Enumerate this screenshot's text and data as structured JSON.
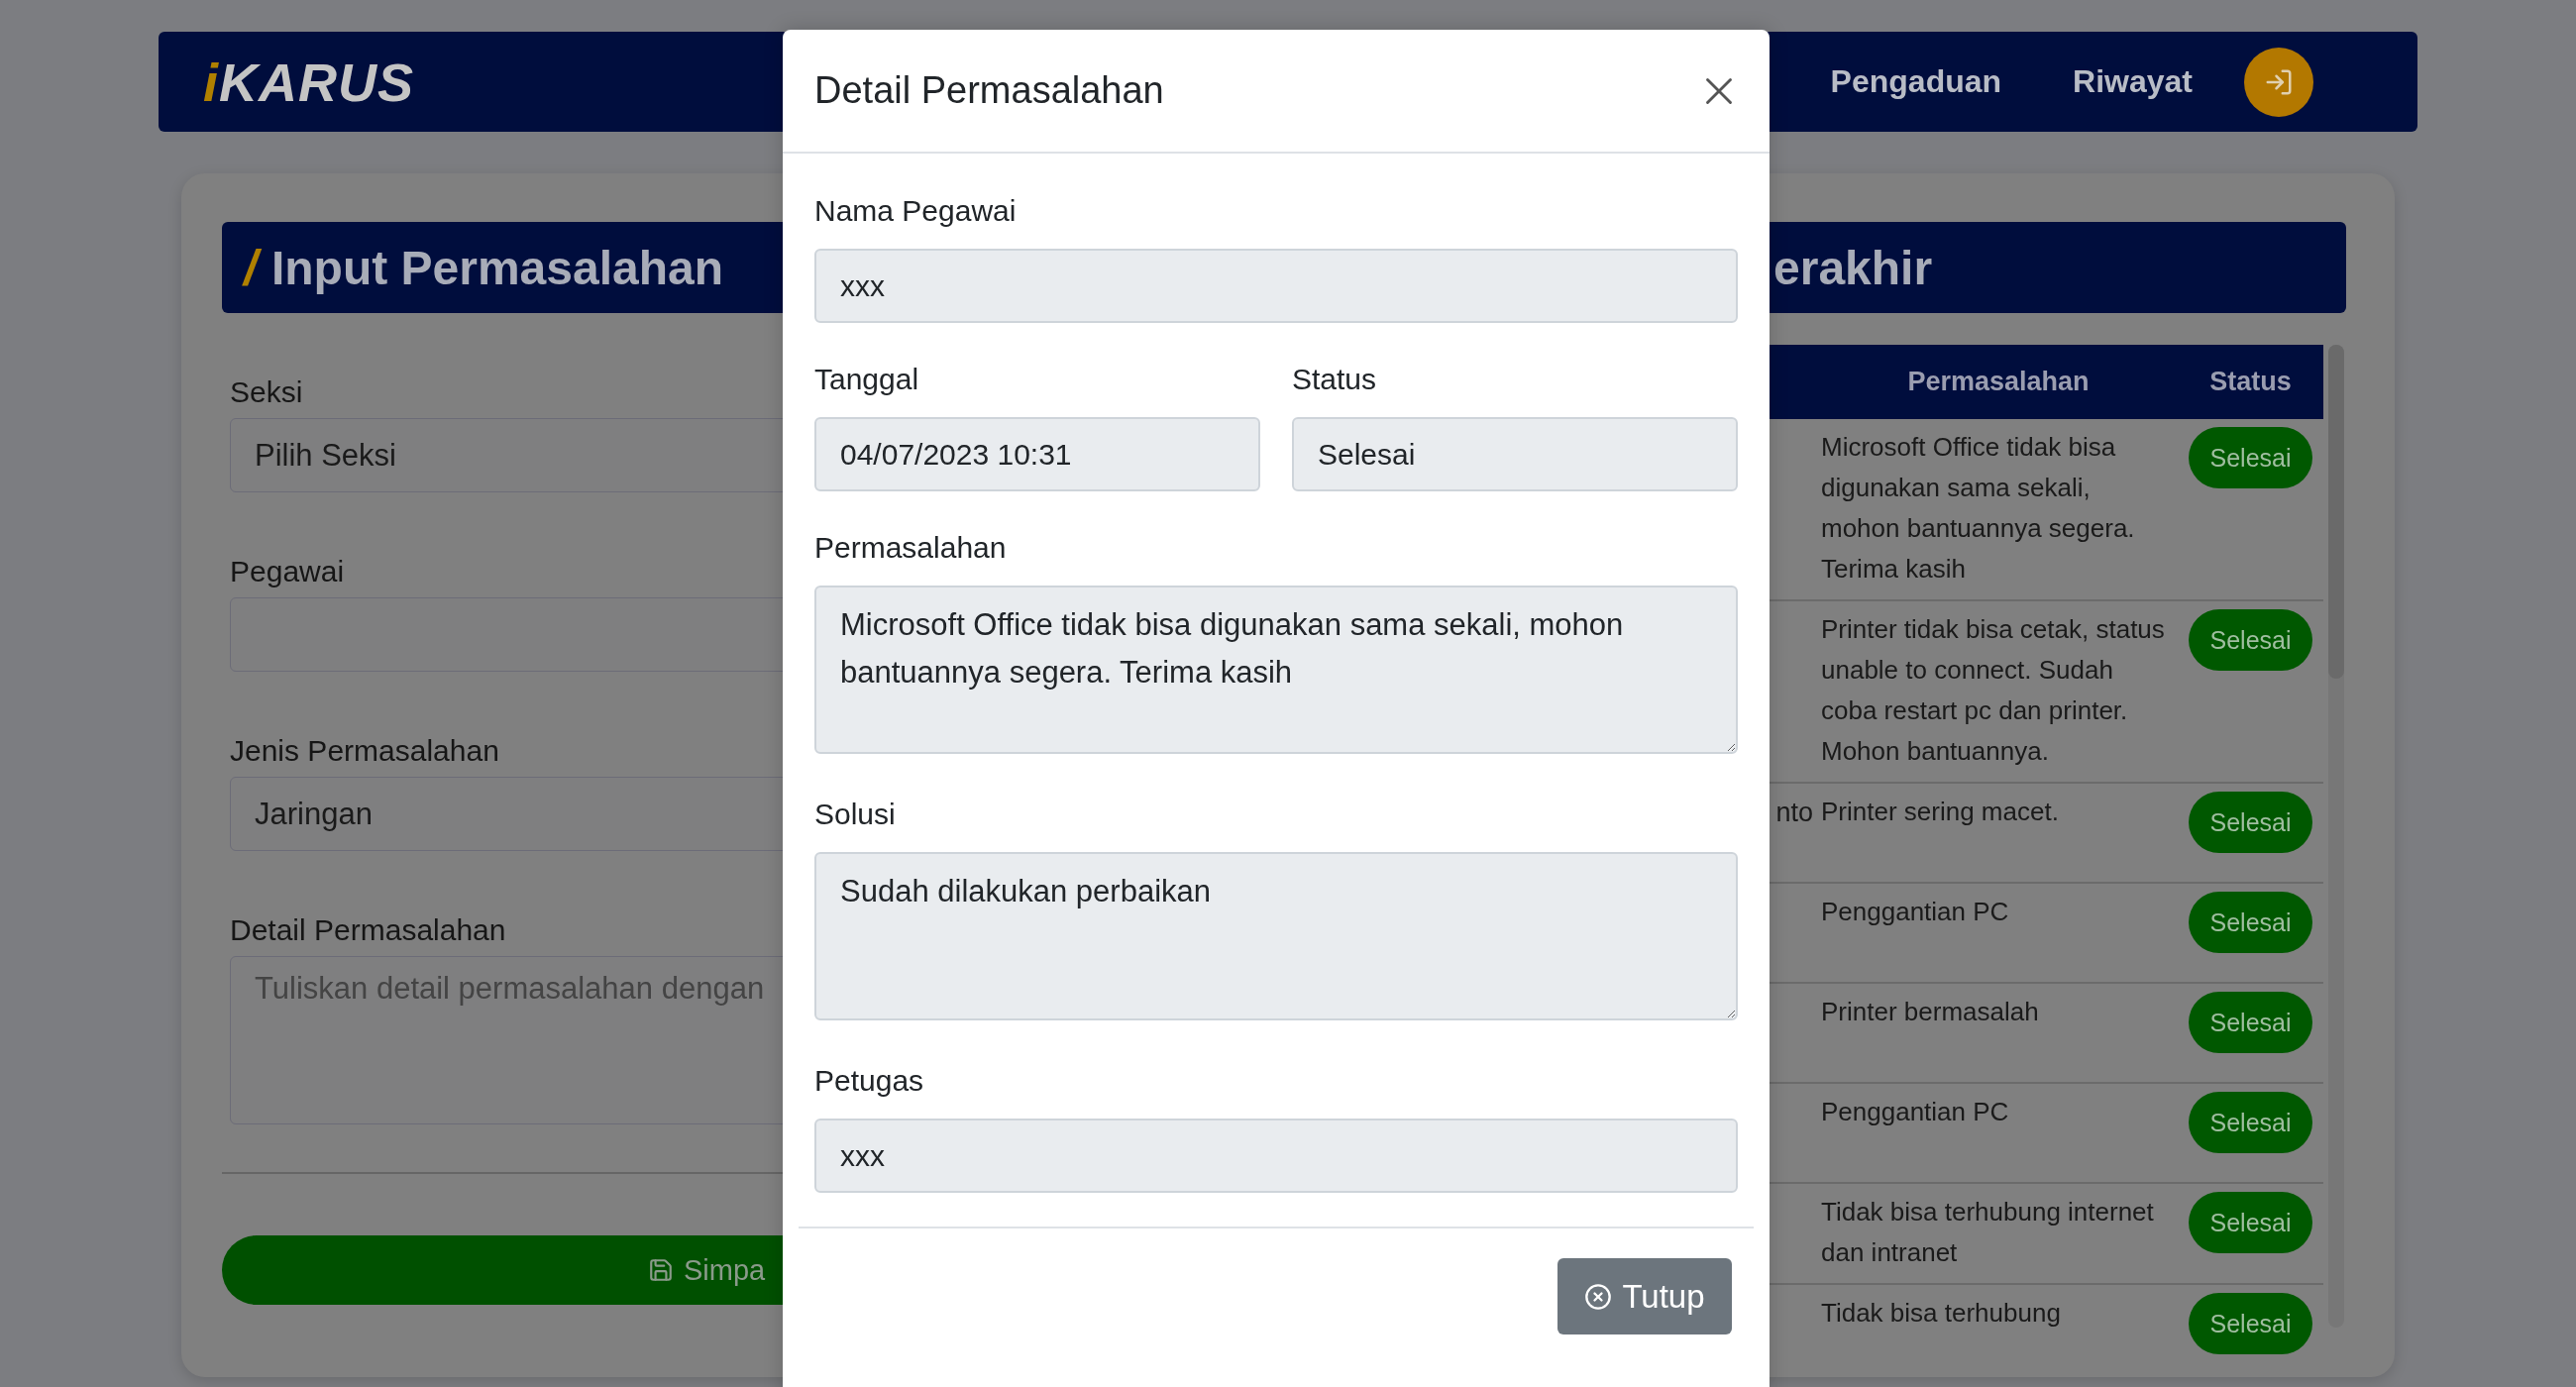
{
  "header": {
    "logo": {
      "accent": "i",
      "text": "KARUS"
    },
    "nav": [
      {
        "label": "Pengaduan"
      },
      {
        "label": "Riwayat"
      }
    ]
  },
  "input_panel": {
    "title_mark": "/",
    "title": "Input Permasalahan",
    "fields": [
      {
        "kind": "select",
        "label": "Seksi",
        "value": "Pilih Seksi"
      },
      {
        "kind": "input",
        "label": "Pegawai"
      },
      {
        "kind": "select",
        "label": "Jenis Permasalahan",
        "value": "Jaringan"
      },
      {
        "kind": "textarea",
        "label": "Detail Permasalahan",
        "placeholder": "Tuliskan detail permasalahan dengan"
      }
    ],
    "submit": "Simpa"
  },
  "recent_panel": {
    "title": "erakhir",
    "table": {
      "columns": [
        "Permasalahan",
        "Status"
      ],
      "rows": [
        {
          "problem": "Microsoft Office tidak bisa digunakan sama sekali, mohon bantuannya segera. Terima kasih",
          "status": "Selesai"
        },
        {
          "problem": "Printer tidak bisa cetak, status unable to connect. Sudah coba restart pc dan printer. Mohon bantuannya.",
          "status": "Selesai"
        },
        {
          "column_1": "nto",
          "problem": "Printer sering macet.",
          "status": "Selesai"
        },
        {
          "problem": "Penggantian PC",
          "status": "Selesai"
        },
        {
          "problem": "Printer bermasalah",
          "status": "Selesai"
        },
        {
          "problem": "Penggantian PC",
          "status": "Selesai"
        },
        {
          "problem": "Tidak bisa terhubung internet dan intranet",
          "status": "Selesai"
        },
        {
          "problem": "Tidak bisa terhubung",
          "status": "Selesai"
        }
      ]
    }
  },
  "modal": {
    "title": "Detail Permasalahan",
    "rows": [
      [
        {
          "kind": "input",
          "label": "Nama Pegawai",
          "value": "xxx"
        }
      ],
      [
        {
          "kind": "input",
          "label": "Tanggal",
          "value": "04/07/2023 10:31"
        },
        {
          "kind": "input",
          "label": "Status",
          "value": "Selesai"
        }
      ],
      [
        {
          "kind": "textarea",
          "label": "Permasalahan",
          "value": "Microsoft Office tidak bisa digunakan sama sekali, mohon bantuannya segera. Terima kasih"
        }
      ],
      [
        {
          "kind": "textarea",
          "label": "Solusi",
          "value": "Sudah dilakukan perbaikan"
        }
      ],
      [
        {
          "kind": "input",
          "label": "Petugas",
          "value": "xxx"
        }
      ]
    ],
    "close_button": "Tutup"
  }
}
